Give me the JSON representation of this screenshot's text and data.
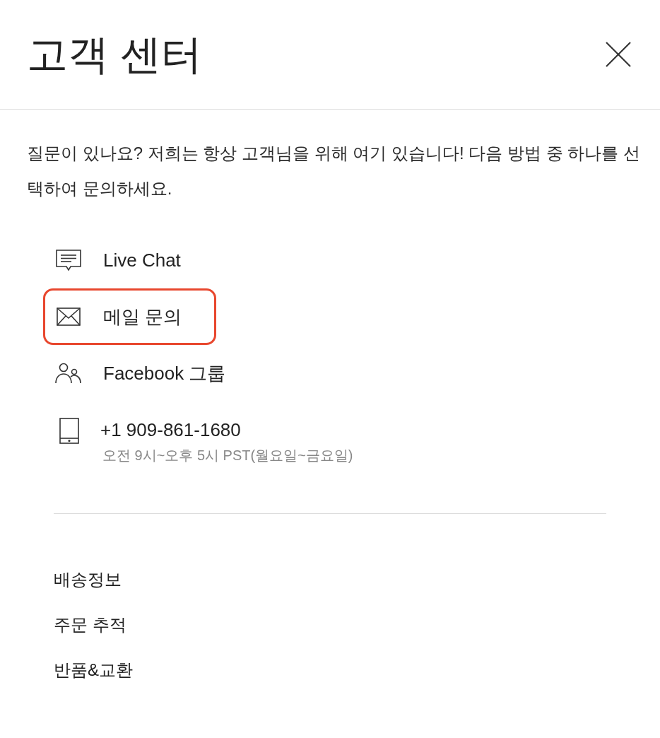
{
  "header": {
    "title": "고객 센터"
  },
  "intro": "질문이 있나요? 저희는 항상 고객님을 위해 여기 있습니다! 다음 방법 중 하나를 선택하여 문의하세요.",
  "contacts": [
    {
      "kind": "chat",
      "label": "Live Chat",
      "highlighted": false
    },
    {
      "kind": "email",
      "label": "메일 문의",
      "highlighted": true
    },
    {
      "kind": "group",
      "label": "Facebook 그룹",
      "highlighted": false
    },
    {
      "kind": "phone",
      "label": "+1 909-861-1680",
      "hours": "오전 9시~오후 5시 PST(월요일~금요일)",
      "highlighted": false
    }
  ],
  "links": [
    "배송정보",
    "주문 추적",
    "반품&교환"
  ]
}
